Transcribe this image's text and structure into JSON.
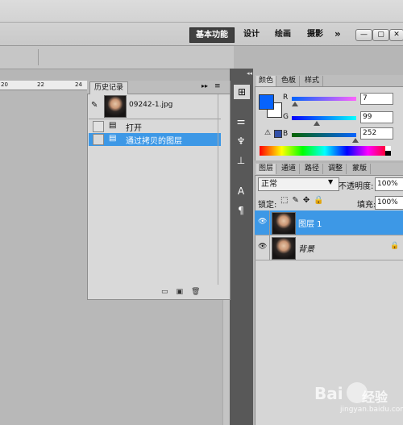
{
  "workspace": {
    "items": [
      "基本功能",
      "设计",
      "绘画",
      "摄影"
    ],
    "more": "»"
  },
  "window_buttons": [
    "—",
    "▢",
    "✕"
  ],
  "ruler": {
    "ticks": [
      "20",
      "22",
      "24"
    ]
  },
  "history": {
    "tab": "历史记录",
    "snapshot_name": "09242-1.jpg",
    "steps": [
      "打开",
      "通过拷贝的图层"
    ]
  },
  "color": {
    "tabs": [
      "颜色",
      "色板",
      "样式"
    ],
    "channels": [
      {
        "label": "R",
        "value": "7"
      },
      {
        "label": "G",
        "value": "99"
      },
      {
        "label": "B",
        "value": "252"
      }
    ],
    "foreground": "#0763fc",
    "background": "#ffffff",
    "warning_swatch": "#3250a8"
  },
  "layers": {
    "tabs": [
      "图层",
      "通道",
      "路径",
      "调整",
      "蒙版"
    ],
    "blend_mode": "正常",
    "opacity_label": "不透明度:",
    "opacity_value": "100%",
    "lock_label": "锁定:",
    "fill_label": "填充:",
    "fill_value": "100%",
    "items": [
      {
        "name": "图层 1",
        "selected": true
      },
      {
        "name": "背景",
        "locked": true
      }
    ]
  },
  "watermark": {
    "logo": "Bai",
    "text": "经验",
    "url": "jingyan.baidu.com"
  },
  "colors": {
    "selection": "#3d98e6",
    "panel": "#d6d6d6",
    "dark": "#585858"
  }
}
